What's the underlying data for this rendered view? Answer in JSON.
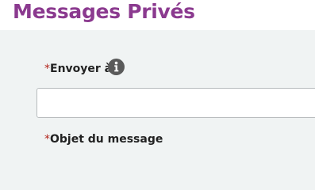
{
  "header": {
    "title": "Messages Privés"
  },
  "form": {
    "recipient": {
      "required_mark": "*",
      "label": "Envoyer à",
      "info_icon": "info-circle",
      "value": "",
      "placeholder": ""
    },
    "subject": {
      "required_mark": "*",
      "label": "Objet du message"
    }
  },
  "colors": {
    "title": "#8b3a8f",
    "required": "#b3261e",
    "panel_background": "#f0f3f3",
    "input_border": "#b8bcbe",
    "info_icon": "#5a5a5a"
  }
}
